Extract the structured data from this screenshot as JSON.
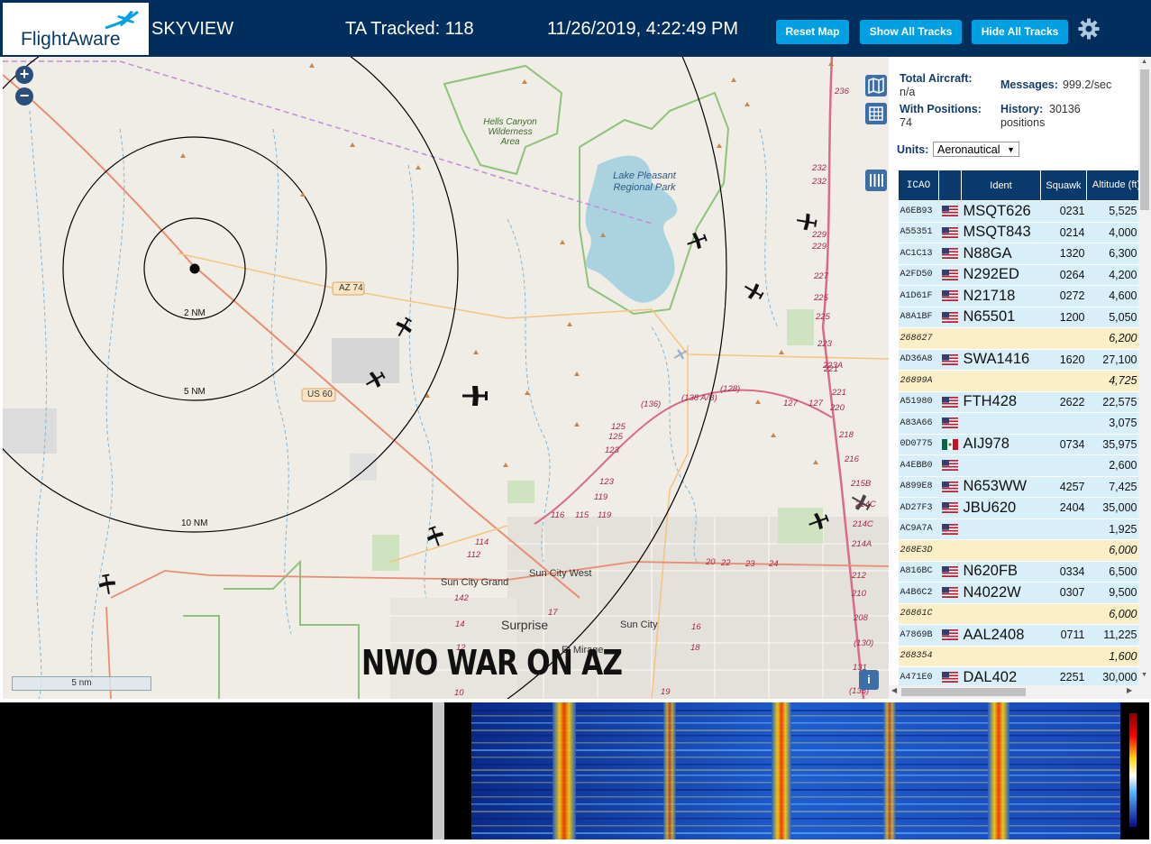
{
  "header": {
    "logo_text": "FlightAware",
    "app_name": "SKYVIEW",
    "tracked": "TA Tracked: 118",
    "datetime": "11/26/2019, 4:22:49 PM",
    "buttons": [
      "Reset Map",
      "Show All Tracks",
      "Hide All Tracks"
    ],
    "settings_icon": "gear-icon"
  },
  "map": {
    "overlay_text": "NWO WAR ON AZ",
    "scale_label": "5 nm",
    "rings": [
      "2 NM",
      "5 NM",
      "10 NM"
    ],
    "places": [
      "Hells Canyon Wilderness Area",
      "Lake Pleasant Regional Park",
      "Sun City West",
      "Sun City Grand",
      "Surprise",
      "Sun City",
      "El Mirage"
    ],
    "roads": [
      "AZ 74",
      "US 60"
    ],
    "mile_markers": [
      "236",
      "232",
      "232",
      "229",
      "229",
      "227",
      "225",
      "225",
      "223",
      "223A",
      "221",
      "221",
      "220",
      "218",
      "216",
      "215B",
      "214C",
      "214C",
      "214A",
      "212",
      "210",
      "208",
      "(130)",
      "131",
      "(135)",
      "(136)",
      "(138 A/B)",
      "(128)",
      "127",
      "127",
      "125",
      "125",
      "123",
      "123",
      "119",
      "119",
      "116",
      "115",
      "114",
      "112",
      "142",
      "14",
      "12",
      "10",
      "17",
      "16",
      "18",
      "19",
      "20",
      "22",
      "23",
      "24"
    ],
    "zoom_in": "+",
    "zoom_out": "−",
    "info": "i"
  },
  "panel": {
    "total_aircraft_label": "Total Aircraft:",
    "total_aircraft_value": "n/a",
    "messages_label": "Messages:",
    "messages_value": "999.2/sec",
    "with_positions_label": "With Positions:",
    "with_positions_value": "74",
    "history_label": "History:",
    "history_value": "30136",
    "history_unit": "positions",
    "units_label": "Units:",
    "units_value": "Aeronautical",
    "columns": [
      "ICAO",
      "",
      "Ident",
      "Squawk",
      "Altitude (ft)"
    ],
    "rows": [
      {
        "icao": "A6EB93",
        "flag": "us",
        "ident": "MSQT626",
        "squawk": "0231",
        "alt": "5,525",
        "trend": "",
        "style": "r"
      },
      {
        "icao": "A55351",
        "flag": "us",
        "ident": "MSQT843",
        "squawk": "0214",
        "alt": "4,000",
        "trend": "▼",
        "style": "r"
      },
      {
        "icao": "AC1C13",
        "flag": "us",
        "ident": "N88GA",
        "squawk": "1320",
        "alt": "6,300",
        "trend": "▼",
        "style": "r"
      },
      {
        "icao": "A2FD50",
        "flag": "us",
        "ident": "N292ED",
        "squawk": "0264",
        "alt": "4,200",
        "trend": "▲",
        "style": "r"
      },
      {
        "icao": "A1D61F",
        "flag": "us",
        "ident": "N21718",
        "squawk": "0272",
        "alt": "4,600",
        "trend": "▲",
        "style": "r"
      },
      {
        "icao": "A8A1BF",
        "flag": "us",
        "ident": "N65501",
        "squawk": "1200",
        "alt": "5,050",
        "trend": "",
        "style": "r"
      },
      {
        "icao": "268627",
        "flag": "",
        "ident": "",
        "squawk": "",
        "alt": "6,200",
        "trend": "▲",
        "style": "y"
      },
      {
        "icao": "AD36A8",
        "flag": "us",
        "ident": "SWA1416",
        "squawk": "1620",
        "alt": "27,100",
        "trend": "▲",
        "style": "r"
      },
      {
        "icao": "26899A",
        "flag": "",
        "ident": "",
        "squawk": "",
        "alt": "4,725",
        "trend": "▲",
        "style": "y"
      },
      {
        "icao": "A51980",
        "flag": "us",
        "ident": "FTH428",
        "squawk": "2622",
        "alt": "22,575",
        "trend": "▲",
        "style": "r"
      },
      {
        "icao": "A83A66",
        "flag": "us",
        "ident": "",
        "squawk": "",
        "alt": "3,075",
        "trend": "▲",
        "style": "r"
      },
      {
        "icao": "0D0775",
        "flag": "mx",
        "ident": "AIJ978",
        "squawk": "0734",
        "alt": "35,975",
        "trend": "",
        "style": "r"
      },
      {
        "icao": "A4EBB0",
        "flag": "us",
        "ident": "",
        "squawk": "",
        "alt": "2,600",
        "trend": "▲",
        "style": "r"
      },
      {
        "icao": "A899E8",
        "flag": "us",
        "ident": "N653WW",
        "squawk": "4257",
        "alt": "7,425",
        "trend": "▼",
        "style": "r"
      },
      {
        "icao": "AD27F3",
        "flag": "us",
        "ident": "JBU620",
        "squawk": "2404",
        "alt": "35,000",
        "trend": "",
        "style": "r"
      },
      {
        "icao": "AC9A7A",
        "flag": "us",
        "ident": "",
        "squawk": "",
        "alt": "1,925",
        "trend": "▲",
        "style": "r"
      },
      {
        "icao": "268E3D",
        "flag": "",
        "ident": "",
        "squawk": "",
        "alt": "6,000",
        "trend": "",
        "style": "y"
      },
      {
        "icao": "A816BC",
        "flag": "us",
        "ident": "N620FB",
        "squawk": "0334",
        "alt": "6,500",
        "trend": "▲",
        "style": "r"
      },
      {
        "icao": "A4B6C2",
        "flag": "us",
        "ident": "N4022W",
        "squawk": "0307",
        "alt": "9,500",
        "trend": "",
        "style": "r"
      },
      {
        "icao": "26861C",
        "flag": "",
        "ident": "",
        "squawk": "",
        "alt": "6,000",
        "trend": "",
        "style": "y"
      },
      {
        "icao": "A7869B",
        "flag": "us",
        "ident": "AAL2408",
        "squawk": "0711",
        "alt": "11,225",
        "trend": "▲",
        "style": "r"
      },
      {
        "icao": "268354",
        "flag": "",
        "ident": "",
        "squawk": "",
        "alt": "1,600",
        "trend": "",
        "style": "y"
      },
      {
        "icao": "A471E0",
        "flag": "us",
        "ident": "DAL402",
        "squawk": "2251",
        "alt": "30,000",
        "trend": "",
        "style": "r"
      }
    ]
  },
  "colors": {
    "header_bg": "#002f5d",
    "button_bg": "#00a0e2",
    "table_header_bg": "#0a3a6b",
    "row_blue": "#d8eef9",
    "row_yellow": "#fbefc7"
  }
}
